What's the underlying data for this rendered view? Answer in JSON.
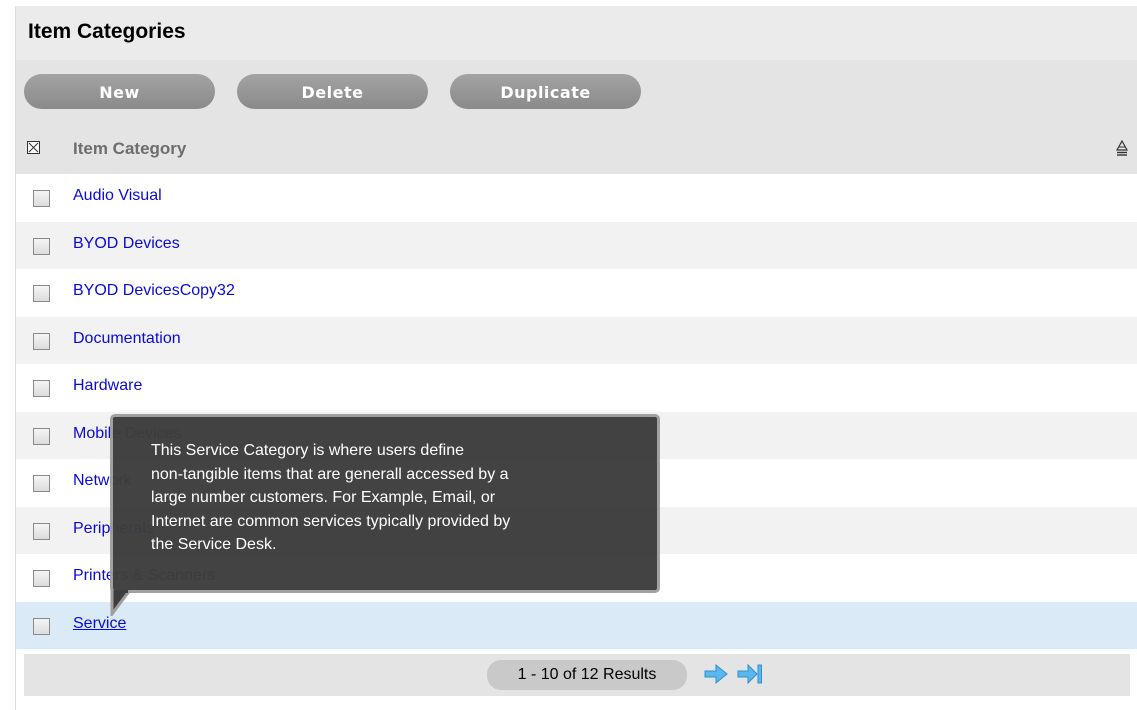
{
  "page": {
    "title": "Item Categories"
  },
  "toolbar": {
    "new_label": "New",
    "delete_label": "Delete",
    "duplicate_label": "Duplicate"
  },
  "grid": {
    "column_header": "Item Category",
    "sort_icon": "sort-ascending-icon",
    "rows": [
      {
        "label": "Audio Visual",
        "checked": false
      },
      {
        "label": "BYOD Devices",
        "checked": false
      },
      {
        "label": "BYOD DevicesCopy32",
        "checked": false
      },
      {
        "label": "Documentation",
        "checked": false
      },
      {
        "label": "Hardware",
        "checked": false
      },
      {
        "label": "Mobile Devices",
        "checked": false
      },
      {
        "label": "Network",
        "checked": false
      },
      {
        "label": "Peripherals",
        "checked": false
      },
      {
        "label": "Printers & Scanners",
        "checked": false
      },
      {
        "label": "Service",
        "checked": false,
        "selected": true
      }
    ]
  },
  "pager": {
    "results": "1 - 10 of 12 Results",
    "next_icon": "arrow-right-icon",
    "last_icon": "arrow-last-icon"
  },
  "tooltip": {
    "lines": [
      "This Service Category is where users define",
      "non-tangible items that are generall accessed by a",
      "large number customers. For Example, Email, or",
      "Internet are common services typically provided by",
      "the Service Desk."
    ]
  },
  "colors": {
    "link": "#0a0ad8",
    "selected_row": "#daeaf7",
    "button": "#8a8a8a",
    "tooltip_bg": "#3d3d3d"
  }
}
